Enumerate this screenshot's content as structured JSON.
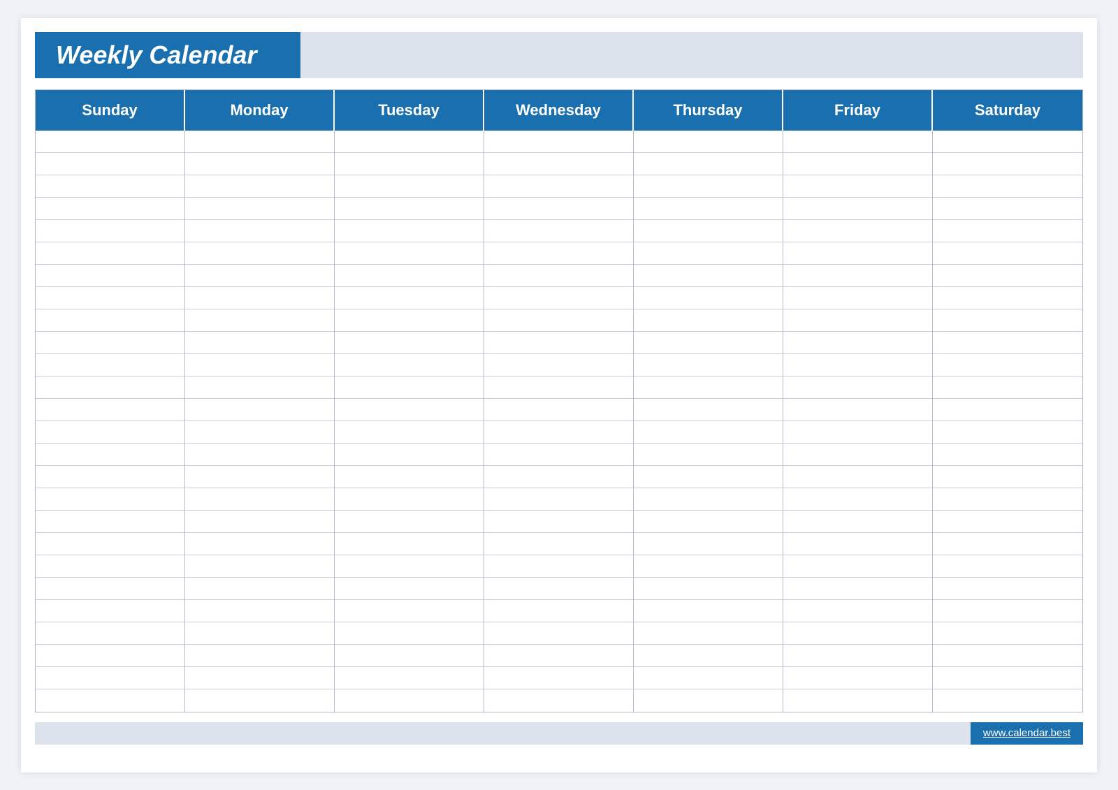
{
  "header": {
    "title": "Weekly Calendar",
    "accent_color": "#1a6faf",
    "bg_light": "#dde3ed"
  },
  "days": [
    {
      "label": "Sunday"
    },
    {
      "label": "Monday"
    },
    {
      "label": "Tuesday"
    },
    {
      "label": "Wednesday"
    },
    {
      "label": "Thursday"
    },
    {
      "label": "Friday"
    },
    {
      "label": "Saturday"
    }
  ],
  "rows_count": 26,
  "footer": {
    "url": "www.calendar.best"
  }
}
